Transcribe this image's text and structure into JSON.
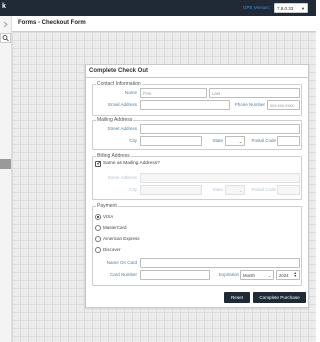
{
  "app": {
    "brand": "k",
    "version_label": "GPE Version:",
    "version_value": "7.8.0.33"
  },
  "sidebar": {
    "search_icon": "search-icon",
    "top_icon": "menu-handle-icon"
  },
  "page": {
    "title": "Forms - Checkout Form"
  },
  "form": {
    "title": "Complete Check Out",
    "contact": {
      "legend": "Contact Information",
      "name_label": "Name",
      "first_placeholder": "First",
      "last_placeholder": "Last",
      "email_label": "Email Address",
      "phone_label": "Phone Number",
      "phone_placeholder": "xxx-xxx-xxxx"
    },
    "mailing": {
      "legend": "Mailing Address",
      "street_label": "Street Address",
      "city_label": "City",
      "state_label": "State",
      "postal_label": "Postal Code"
    },
    "billing": {
      "legend": "Billing Address",
      "same_label": "Same as Mailing Address?",
      "same_checked": true,
      "street_label": "Street Address",
      "city_label": "City",
      "state_label": "State",
      "postal_label": "Postal Code"
    },
    "payment": {
      "legend": "Payment",
      "options": [
        "VISA",
        "MasterCard",
        "American Express",
        "Discover"
      ],
      "selected": "VISA",
      "name_label": "Name On Card",
      "card_label": "Card Number",
      "expiration_label": "Expiration",
      "month_value": "Month",
      "year_value": "2024"
    },
    "buttons": {
      "reset": "Reset",
      "submit": "Complete Purchase"
    }
  },
  "colors": {
    "header_bg": "#1f2a36",
    "label_blue": "#4a7fb5",
    "button_bg": "#1f2a36"
  }
}
